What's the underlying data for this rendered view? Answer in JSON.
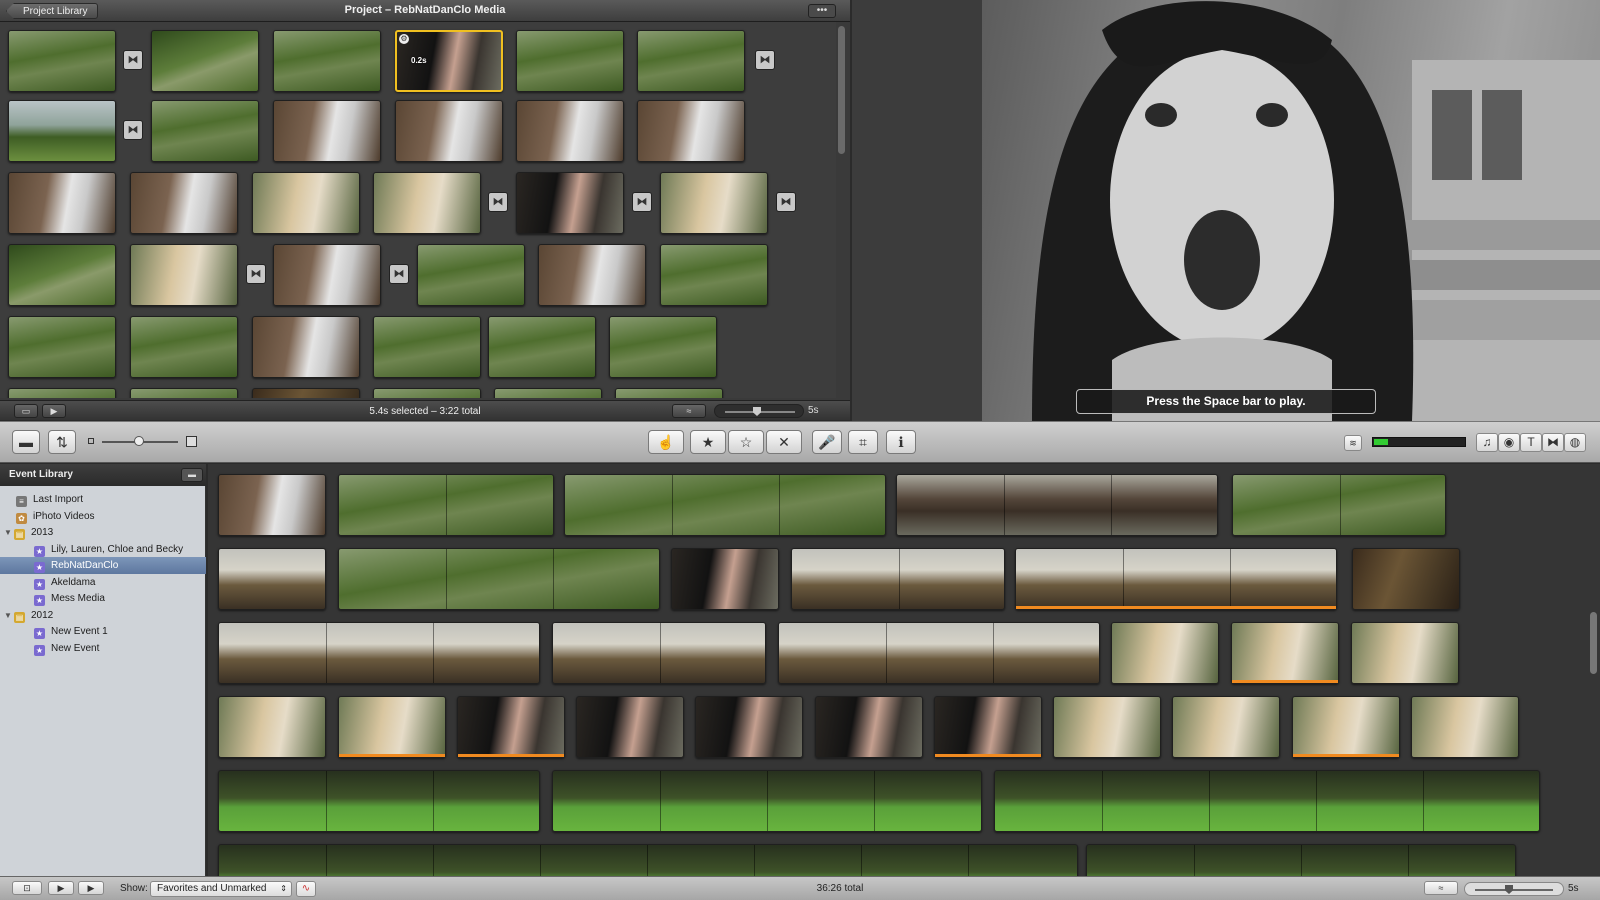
{
  "project": {
    "library_button": "Project Library",
    "title": "Project – RebNatDanClo Media",
    "status": "5.4s selected – 3:22 total",
    "zoom_label": "5s",
    "selected_clip_label": "0.2s"
  },
  "viewer": {
    "hint": "Press the Space bar to play."
  },
  "event_library": {
    "header": "Event Library",
    "items": [
      {
        "label": "Last Import",
        "icon": "film-stack-icon",
        "level": 0
      },
      {
        "label": "iPhoto Videos",
        "icon": "iphoto-icon",
        "level": 0
      },
      {
        "label": "2013",
        "icon": "folder-icon",
        "level": 0,
        "disclosure": "open"
      },
      {
        "label": "Lily, Lauren, Chloe and Becky",
        "icon": "event-star-icon",
        "level": 1
      },
      {
        "label": "RebNatDanClo",
        "icon": "event-star-icon",
        "level": 1,
        "selected": true
      },
      {
        "label": "Akeldama",
        "icon": "event-star-icon",
        "level": 1
      },
      {
        "label": "Mess Media",
        "icon": "event-star-icon",
        "level": 1
      },
      {
        "label": "2012",
        "icon": "folder-icon",
        "level": 0,
        "disclosure": "open"
      },
      {
        "label": "New Event 1",
        "icon": "event-star-icon",
        "level": 1
      },
      {
        "label": "New Event",
        "icon": "event-star-icon",
        "level": 1
      }
    ]
  },
  "bottom": {
    "show_label": "Show:",
    "show_value": "Favorites and Unmarked",
    "total": "36:26 total",
    "zoom_label": "5s"
  },
  "toolbar": {
    "tools": [
      {
        "name": "select-tool-icon",
        "glyph": "☝"
      },
      {
        "name": "favorite-star-icon",
        "glyph": "★"
      },
      {
        "name": "unmark-star-icon",
        "glyph": "☆"
      },
      {
        "name": "reject-icon",
        "glyph": "✕"
      },
      {
        "name": "voiceover-mic-icon",
        "glyph": "🎤"
      },
      {
        "name": "crop-icon",
        "glyph": "⌗"
      },
      {
        "name": "info-icon",
        "glyph": "ℹ"
      }
    ],
    "right_tools": [
      {
        "name": "music-icon",
        "glyph": "♫"
      },
      {
        "name": "photo-camera-icon",
        "glyph": "◉"
      },
      {
        "name": "title-text-icon",
        "glyph": "T"
      },
      {
        "name": "transitions-icon",
        "glyph": "⧓"
      },
      {
        "name": "maps-globe-icon",
        "glyph": "◍"
      }
    ]
  },
  "colors": {
    "selection": "#6480a8",
    "audio_meter": "#38c238",
    "clip_forest": "#4a6b2c",
    "clip_grey": "#8a8a80",
    "clip_face": "#c9a08c"
  }
}
